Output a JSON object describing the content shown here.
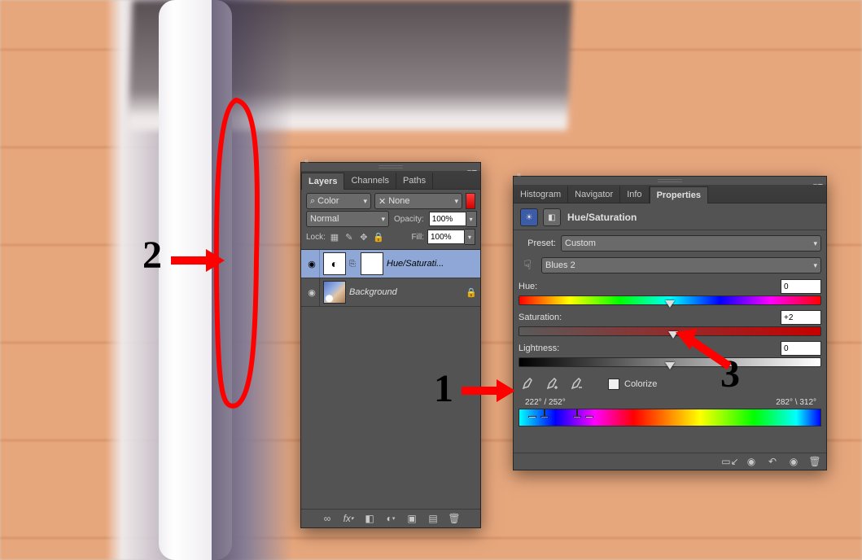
{
  "annotations": {
    "num1": "1",
    "num2": "2",
    "num3": "3"
  },
  "layers_panel": {
    "tabs": {
      "layers": "Layers",
      "channels": "Channels",
      "paths": "Paths"
    },
    "filter_kind": "Color",
    "filter_value": "None",
    "blend_mode": "Normal",
    "opacity_label": "Opacity:",
    "opacity_value": "100%",
    "lock_label": "Lock:",
    "fill_label": "Fill:",
    "fill_value": "100%",
    "layers": [
      {
        "name": "Hue/Saturati...",
        "selected": true
      },
      {
        "name": "Background",
        "locked": true
      }
    ]
  },
  "props_panel": {
    "tabs": {
      "histogram": "Histogram",
      "navigator": "Navigator",
      "info": "Info",
      "properties": "Properties"
    },
    "title": "Hue/Saturation",
    "preset_label": "Preset:",
    "preset_value": "Custom",
    "channel_value": "Blues 2",
    "hue": {
      "label": "Hue:",
      "value": "0"
    },
    "saturation": {
      "label": "Saturation:",
      "value": "+2"
    },
    "lightness": {
      "label": "Lightness:",
      "value": "0"
    },
    "colorize_label": "Colorize",
    "range_left": "222° / 252°",
    "range_right": "282° \\ 312°"
  }
}
